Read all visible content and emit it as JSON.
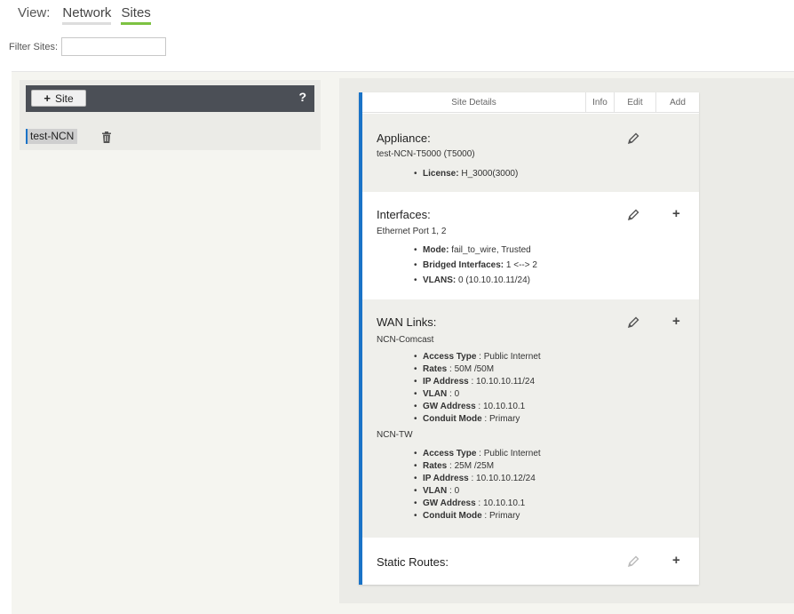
{
  "view": {
    "label": "View:",
    "tabs": [
      {
        "label": "Network",
        "active": false
      },
      {
        "label": "Sites",
        "active": true
      }
    ]
  },
  "filter": {
    "label": "Filter Sites:",
    "value": ""
  },
  "site_panel": {
    "add_label": "Site",
    "help": "?",
    "sites": [
      {
        "name": "test-NCN"
      }
    ]
  },
  "details": {
    "headers": [
      "Site Details",
      "Info",
      "Edit",
      "Add"
    ],
    "appliance": {
      "title": "Appliance:",
      "name": "test-NCN-T5000 (T5000)",
      "license_key": "License:",
      "license_val": " H_3000(3000)"
    },
    "interfaces": {
      "title": "Interfaces:",
      "ports": "Ethernet Port 1, 2",
      "items": [
        {
          "k": "Mode:",
          "v": " fail_to_wire, Trusted"
        },
        {
          "k": "Bridged Interfaces:",
          "v": " 1 <--> 2"
        },
        {
          "k": "VLANS:",
          "v": " 0 (10.10.10.11/24)"
        }
      ]
    },
    "wan_links": {
      "title": "WAN Links:",
      "links": [
        {
          "name": "NCN-Comcast",
          "items": [
            {
              "k": "Access Type",
              "v": " : Public Internet"
            },
            {
              "k": "Rates",
              "v": " : 50M /50M"
            },
            {
              "k": "IP Address",
              "v": " : 10.10.10.11/24"
            },
            {
              "k": "VLAN",
              "v": " : 0"
            },
            {
              "k": "GW Address",
              "v": " : 10.10.10.1"
            },
            {
              "k": "Conduit Mode",
              "v": " : Primary"
            }
          ]
        },
        {
          "name": "NCN-TW",
          "items": [
            {
              "k": "Access Type",
              "v": " : Public Internet"
            },
            {
              "k": "Rates",
              "v": " : 25M /25M"
            },
            {
              "k": "IP Address",
              "v": " : 10.10.10.12/24"
            },
            {
              "k": "VLAN",
              "v": " : 0"
            },
            {
              "k": "GW Address",
              "v": " : 10.10.10.1"
            },
            {
              "k": "Conduit Mode",
              "v": " : Primary"
            }
          ]
        }
      ]
    },
    "static_routes": {
      "title": "Static Routes:"
    }
  },
  "colors": {
    "accent_blue": "#1a73c7",
    "active_tab": "#7dc242",
    "header_dark": "#4b4f56"
  },
  "icons": {
    "edit": "pencil-icon",
    "add": "plus-icon",
    "delete": "trash-icon"
  }
}
